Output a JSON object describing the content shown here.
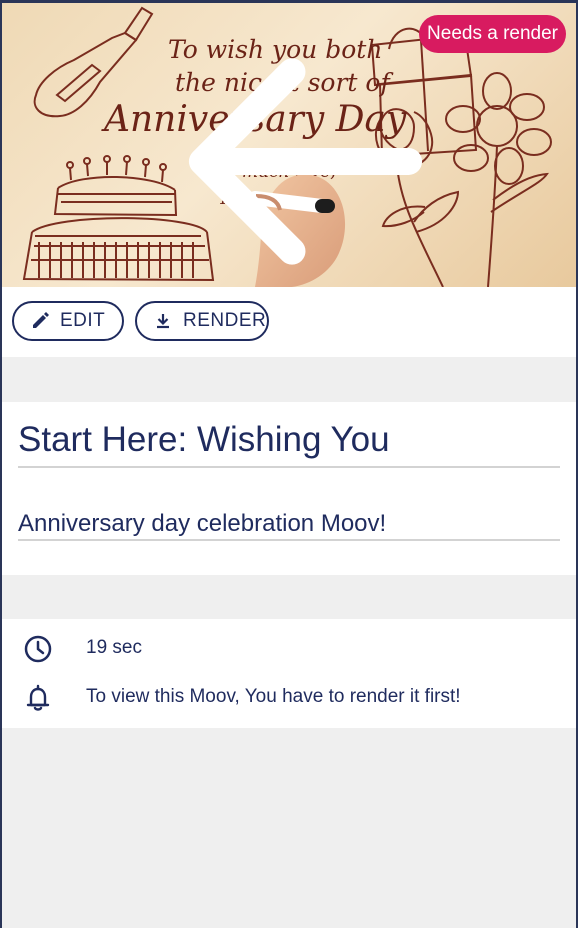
{
  "hero": {
    "image_caption_lines": [
      "To wish you both",
      "the nicest sort of",
      "Anniversary Day",
      "much love,",
      "The"
    ],
    "badge": "Needs a render",
    "back_icon": "arrow-left-icon"
  },
  "actions": {
    "edit_label": "EDIT",
    "edit_icon": "pencil-icon",
    "render_label": "RENDER",
    "render_icon": "download-icon"
  },
  "details": {
    "title": "Start Here: Wishing You",
    "description": "Anniversary day celebration Moov!"
  },
  "meta": {
    "duration": "19 sec",
    "duration_icon": "clock-icon",
    "render_notice": "To view this Moov, You have to render it first!",
    "render_icon": "bell-icon"
  },
  "colors": {
    "accent": "#1f2b5e",
    "badge": "#d81b60",
    "background": "#efefef"
  }
}
